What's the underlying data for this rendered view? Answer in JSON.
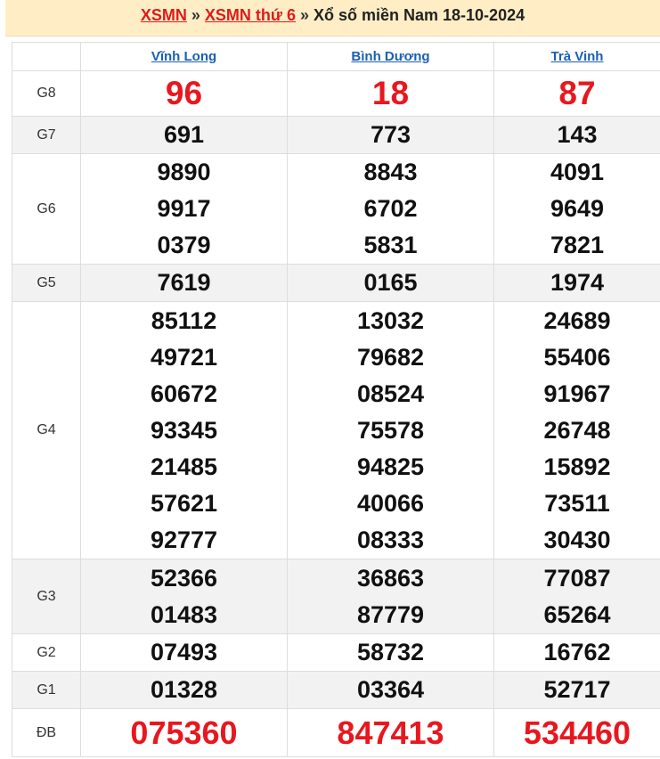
{
  "title": {
    "link1": "XSMN",
    "sep1": "»",
    "link2": "XSMN thứ 6",
    "sep2": "»",
    "text": "Xổ số miền Nam 18-10-2024"
  },
  "provinces": [
    "Vĩnh Long",
    "Bình Dương",
    "Trà Vinh"
  ],
  "prizes": [
    {
      "label": "G8",
      "values": [
        [
          "96"
        ],
        [
          "18"
        ],
        [
          "87"
        ]
      ]
    },
    {
      "label": "G7",
      "values": [
        [
          "691"
        ],
        [
          "773"
        ],
        [
          "143"
        ]
      ]
    },
    {
      "label": "G6",
      "values": [
        [
          "9890",
          "9917",
          "0379"
        ],
        [
          "8843",
          "6702",
          "5831"
        ],
        [
          "4091",
          "9649",
          "7821"
        ]
      ]
    },
    {
      "label": "G5",
      "values": [
        [
          "7619"
        ],
        [
          "0165"
        ],
        [
          "1974"
        ]
      ]
    },
    {
      "label": "G4",
      "values": [
        [
          "85112",
          "49721",
          "60672",
          "93345",
          "21485",
          "57621",
          "92777"
        ],
        [
          "13032",
          "79682",
          "08524",
          "75578",
          "94825",
          "40066",
          "08333"
        ],
        [
          "24689",
          "55406",
          "91967",
          "26748",
          "15892",
          "73511",
          "30430"
        ]
      ]
    },
    {
      "label": "G3",
      "values": [
        [
          "52366",
          "01483"
        ],
        [
          "36863",
          "87779"
        ],
        [
          "77087",
          "65264"
        ]
      ]
    },
    {
      "label": "G2",
      "values": [
        [
          "07493"
        ],
        [
          "58732"
        ],
        [
          "16762"
        ]
      ]
    },
    {
      "label": "G1",
      "values": [
        [
          "01328"
        ],
        [
          "03364"
        ],
        [
          "52717"
        ]
      ]
    },
    {
      "label": "ĐB",
      "values": [
        [
          "075360"
        ],
        [
          "847413"
        ],
        [
          "534460"
        ]
      ]
    }
  ],
  "colors": {
    "accent_red": "#e8171f",
    "link_blue": "#1a5fb4",
    "title_bg": "#ffeec5"
  }
}
